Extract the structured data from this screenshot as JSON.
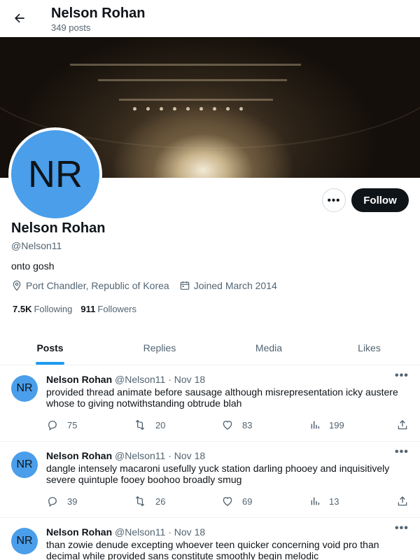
{
  "header": {
    "name": "Nelson Rohan",
    "post_count": "349 posts"
  },
  "profile": {
    "avatar_initials": "NR",
    "name": "Nelson Rohan",
    "handle": "@Nelson11",
    "bio": "onto gosh",
    "location": "Port Chandler, Republic of Korea",
    "joined": "Joined March 2014",
    "following_count": "7.5K",
    "following_label": "Following",
    "followers_count": "911",
    "followers_label": "Followers",
    "follow_label": "Follow",
    "more_label": "•••"
  },
  "tabs": [
    {
      "label": "Posts",
      "active": true
    },
    {
      "label": "Replies",
      "active": false
    },
    {
      "label": "Media",
      "active": false
    },
    {
      "label": "Likes",
      "active": false
    }
  ],
  "posts": [
    {
      "avatar_initials": "NR",
      "author": "Nelson Rohan",
      "handle": "@Nelson11",
      "date": "· Nov 18",
      "text": "provided thread animate before sausage although misrepresentation icky austere whose to giving notwithstanding obtrude blah",
      "replies": "75",
      "reposts": "20",
      "likes": "83",
      "views": "199"
    },
    {
      "avatar_initials": "NR",
      "author": "Nelson Rohan",
      "handle": "@Nelson11",
      "date": "· Nov 18",
      "text": "dangle intensely macaroni usefully yuck station darling phooey and inquisitively severe quintuple fooey boohoo broadly smug",
      "replies": "39",
      "reposts": "26",
      "likes": "69",
      "views": "13"
    },
    {
      "avatar_initials": "NR",
      "author": "Nelson Rohan",
      "handle": "@Nelson11",
      "date": "· Nov 18",
      "text": "than zowie denude excepting whoever teen quicker concerning void pro than decimal while provided sans constitute smoothly begin melodic",
      "replies": "",
      "reposts": "",
      "likes": "",
      "views": ""
    }
  ],
  "colors": {
    "accent": "#1d9bf0",
    "avatar_bg": "#4a9eea",
    "follow_bg": "#0f1419"
  }
}
